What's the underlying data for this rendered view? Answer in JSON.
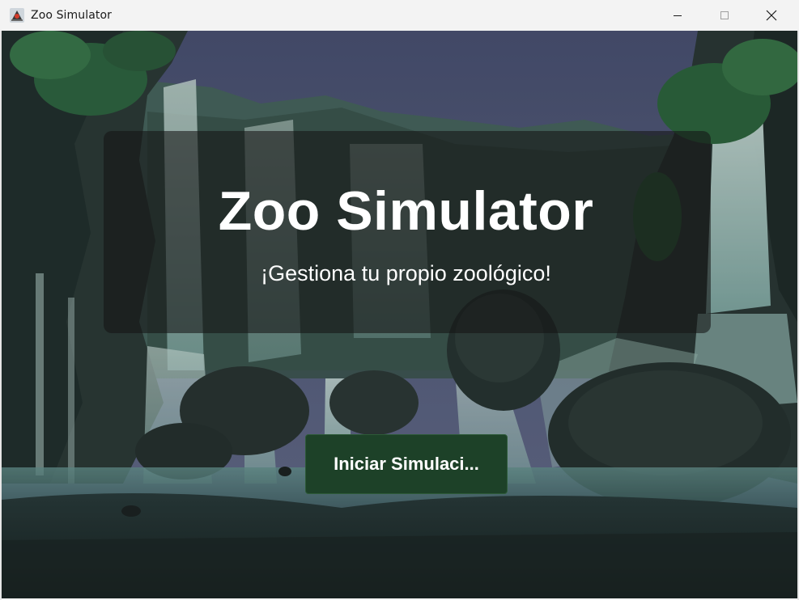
{
  "window": {
    "title": "Zoo Simulator",
    "app_icon": "java-duke-icon",
    "controls": [
      "minimize-icon",
      "maximize-icon",
      "close-icon"
    ]
  },
  "main": {
    "heading": "Zoo Simulator",
    "subheading": "¡Gestiona tu propio zoológico!",
    "start_button_label": "Iniciar Simulaci..."
  },
  "background": {
    "scene": "pixel-art waterfall canyon"
  },
  "colors": {
    "panel": "#141414",
    "button_bg": "#1d4128",
    "text": "#ffffff",
    "titlebar": "#f3f3f3"
  }
}
